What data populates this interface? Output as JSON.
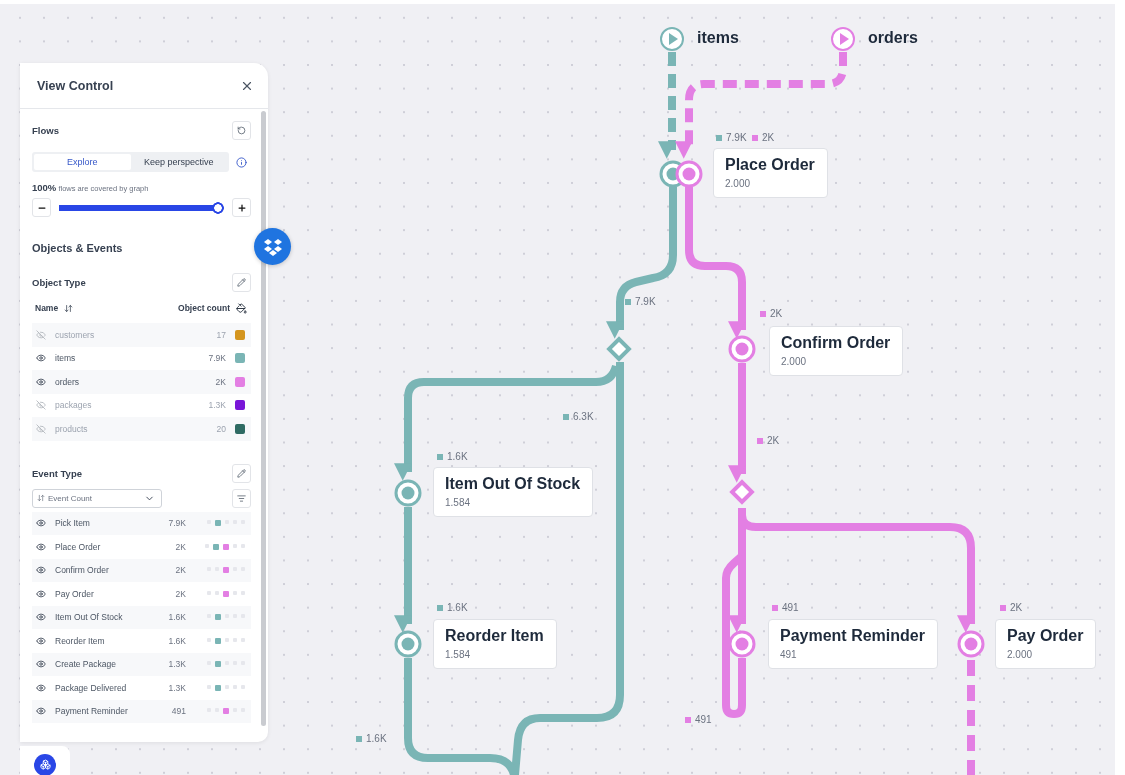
{
  "panel": {
    "title": "View Control",
    "flows": {
      "title": "Flows",
      "modes": [
        {
          "label": "Explore",
          "selected": true
        },
        {
          "label": "Keep perspective",
          "selected": false
        }
      ],
      "coverage_value": "100%",
      "coverage_text": "flows are covered by graph",
      "level": 1
    },
    "objects_events_title": "Objects & Events",
    "object_type": {
      "title": "Object Type",
      "name_column": "Name",
      "count_column": "Object count",
      "rows": [
        {
          "name": "customers",
          "count": "17",
          "visible": false,
          "color": "#d4951f"
        },
        {
          "name": "items",
          "count": "7.9K",
          "visible": true,
          "color": "#7ab5b5"
        },
        {
          "name": "orders",
          "count": "2K",
          "visible": true,
          "color": "#e37fe3"
        },
        {
          "name": "packages",
          "count": "1.3K",
          "visible": false,
          "color": "#7a16d8"
        },
        {
          "name": "products",
          "count": "20",
          "visible": false,
          "color": "#2f6b63"
        }
      ]
    },
    "event_type": {
      "title": "Event Type",
      "sort": "Event Count",
      "rows": [
        {
          "name": "Pick Item",
          "count": "7.9K",
          "visible": true,
          "lanes": [
            {
              "filled": false
            },
            {
              "filled": true,
              "color": "#7ab5b5"
            },
            {
              "filled": false
            },
            {
              "filled": false
            },
            {
              "filled": false
            }
          ]
        },
        {
          "name": "Place Order",
          "count": "2K",
          "visible": true,
          "lanes": [
            {
              "filled": false
            },
            {
              "filled": true,
              "color": "#7ab5b5"
            },
            {
              "filled": true,
              "color": "#e37fe3"
            },
            {
              "filled": false
            },
            {
              "filled": false
            }
          ]
        },
        {
          "name": "Confirm Order",
          "count": "2K",
          "visible": true,
          "lanes": [
            {
              "filled": false
            },
            {
              "filled": false
            },
            {
              "filled": true,
              "color": "#e37fe3"
            },
            {
              "filled": false
            },
            {
              "filled": false
            }
          ]
        },
        {
          "name": "Pay Order",
          "count": "2K",
          "visible": true,
          "lanes": [
            {
              "filled": false
            },
            {
              "filled": false
            },
            {
              "filled": true,
              "color": "#e37fe3"
            },
            {
              "filled": false
            },
            {
              "filled": false
            }
          ]
        },
        {
          "name": "Item Out Of Stock",
          "count": "1.6K",
          "visible": true,
          "lanes": [
            {
              "filled": false
            },
            {
              "filled": true,
              "color": "#7ab5b5"
            },
            {
              "filled": false
            },
            {
              "filled": false
            },
            {
              "filled": false
            }
          ]
        },
        {
          "name": "Reorder Item",
          "count": "1.6K",
          "visible": true,
          "lanes": [
            {
              "filled": false
            },
            {
              "filled": true,
              "color": "#7ab5b5"
            },
            {
              "filled": false
            },
            {
              "filled": false
            },
            {
              "filled": false
            }
          ]
        },
        {
          "name": "Create Package",
          "count": "1.3K",
          "visible": true,
          "lanes": [
            {
              "filled": false
            },
            {
              "filled": true,
              "color": "#7ab5b5"
            },
            {
              "filled": false
            },
            {
              "filled": false
            },
            {
              "filled": false
            }
          ]
        },
        {
          "name": "Package Delivered",
          "count": "1.3K",
          "visible": true,
          "lanes": [
            {
              "filled": false
            },
            {
              "filled": true,
              "color": "#7ab5b5"
            },
            {
              "filled": false
            },
            {
              "filled": false
            },
            {
              "filled": false
            }
          ]
        },
        {
          "name": "Payment Reminder",
          "count": "491",
          "visible": true,
          "lanes": [
            {
              "filled": false
            },
            {
              "filled": false
            },
            {
              "filled": true,
              "color": "#e37fe3"
            },
            {
              "filled": false
            },
            {
              "filled": false
            }
          ]
        }
      ]
    }
  },
  "graph": {
    "sources": [
      {
        "label": "items",
        "color": "#7ab5b5"
      },
      {
        "label": "orders",
        "color": "#e37fe3"
      }
    ],
    "nodes": [
      {
        "title": "Place Order",
        "count": "2.000",
        "markers": [
          {
            "color": "#7ab5b5"
          },
          {
            "color": "#e37fe3"
          }
        ]
      },
      {
        "title": "Confirm Order",
        "count": "2.000",
        "markers": [
          {
            "color": "#e37fe3"
          }
        ]
      },
      {
        "title": "Item Out Of Stock",
        "count": "1.584",
        "markers": [
          {
            "color": "#7ab5b5"
          }
        ]
      },
      {
        "title": "Reorder Item",
        "count": "1.584",
        "markers": [
          {
            "color": "#7ab5b5"
          }
        ]
      },
      {
        "title": "Payment Reminder",
        "count": "491",
        "markers": [
          {
            "color": "#e37fe3"
          }
        ]
      },
      {
        "title": "Pay Order",
        "count": "2.000",
        "markers": [
          {
            "color": "#e37fe3"
          }
        ]
      }
    ],
    "edge_labels": [
      {
        "text": "7.9K",
        "color": "#7ab5b5"
      },
      {
        "text": "2K",
        "color": "#e37fe3"
      },
      {
        "text": "7.9K",
        "color": "#7ab5b5"
      },
      {
        "text": "2K",
        "color": "#e37fe3"
      },
      {
        "text": "6.3K",
        "color": "#7ab5b5"
      },
      {
        "text": "2K",
        "color": "#e37fe3"
      },
      {
        "text": "1.6K",
        "color": "#7ab5b5"
      },
      {
        "text": "1.6K",
        "color": "#7ab5b5"
      },
      {
        "text": "491",
        "color": "#e37fe3"
      },
      {
        "text": "2K",
        "color": "#e37fe3"
      },
      {
        "text": "491",
        "color": "#e37fe3"
      },
      {
        "text": "1.6K",
        "color": "#7ab5b5"
      }
    ]
  }
}
